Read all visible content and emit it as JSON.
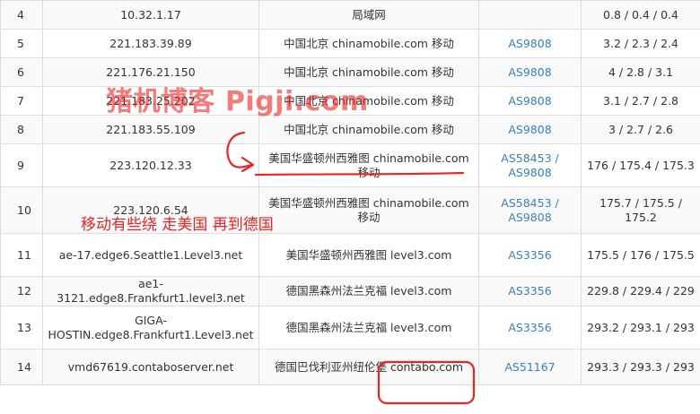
{
  "rows": [
    {
      "hop": "4",
      "ip": "10.32.1.17",
      "geo": "局域网",
      "as": [],
      "rtt": "0.8 / 0.4 / 0.4"
    },
    {
      "hop": "5",
      "ip": "221.183.39.89",
      "geo": "中国北京 chinamobile.com 移动",
      "as": [
        "AS9808"
      ],
      "rtt": "3.2 / 2.3 / 2.4"
    },
    {
      "hop": "6",
      "ip": "221.176.21.150",
      "geo": "中国北京 chinamobile.com 移动",
      "as": [
        "AS9808"
      ],
      "rtt": "4 / 2.8 / 3.1"
    },
    {
      "hop": "7",
      "ip": "221.183.25.202",
      "geo": "中国北京 chinamobile.com 移动",
      "as": [
        "AS9808"
      ],
      "rtt": "3.1 / 2.7 / 2.8"
    },
    {
      "hop": "8",
      "ip": "221.183.55.109",
      "geo": "中国北京 chinamobile.com 移动",
      "as": [
        "AS9808"
      ],
      "rtt": "3 / 2.7 / 2.6"
    },
    {
      "hop": "9",
      "ip": "223.120.12.33",
      "geo": "美国华盛顿州西雅图 chinamobile.com 移动",
      "as": [
        "AS58453 /",
        "AS9808"
      ],
      "rtt": "176 / 175.4 / 175.3"
    },
    {
      "hop": "10",
      "ip": "223.120.6.54",
      "geo": "美国华盛顿州西雅图 chinamobile.com 移动",
      "as": [
        "AS58453 /",
        "AS9808"
      ],
      "rtt": "175.7 / 175.5 / 175.2"
    },
    {
      "hop": "11",
      "ip": "ae-17.edge6.Seattle1.Level3.net",
      "geo": "美国华盛顿州西雅图 level3.com",
      "as": [
        "AS3356"
      ],
      "rtt": "175.5 / 176 / 175.5"
    },
    {
      "hop": "12",
      "ip": "ae1-3121.edge8.Frankfurt1.level3.net",
      "geo": "德国黑森州法兰克福 level3.com",
      "as": [
        "AS3356"
      ],
      "rtt": "229.8 / 229.4 / 229"
    },
    {
      "hop": "13",
      "ip": "GIGA-HOSTIN.edge8.Frankfurt1.Level3.net",
      "geo": "德国黑森州法兰克福 level3.com",
      "as": [
        "AS3356"
      ],
      "rtt": "293.2 / 293.1 / 293"
    },
    {
      "hop": "14",
      "ip": "vmd67619.contaboserver.net",
      "geo": "德国巴伐利亚州纽伦堡 contabo.com",
      "as": [
        "AS51167"
      ],
      "rtt": "293.3 / 293.3 / 293"
    }
  ],
  "watermark": "猪机博客 Pigji.com",
  "annotation": "移动有些绕  走美国 再到德国",
  "colors": {
    "link": "#3a7fc0",
    "mark": "#ee2222",
    "border": "#dddddd",
    "stripe": "#f9f9f9"
  }
}
